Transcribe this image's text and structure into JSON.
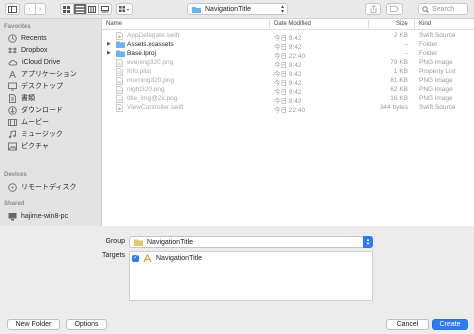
{
  "toolbar": {
    "path_folder": "NavigationTitle",
    "search_placeholder": "Search"
  },
  "sidebar": {
    "favorites_header": "Favorites",
    "favorites": [
      {
        "label": "Recents",
        "icon": "clock-icon"
      },
      {
        "label": "Dropbox",
        "icon": "dropbox-icon"
      },
      {
        "label": "iCloud Drive",
        "icon": "cloud-icon"
      },
      {
        "label": "アプリケーション",
        "icon": "applications-icon"
      },
      {
        "label": "デスクトップ",
        "icon": "desktop-icon"
      },
      {
        "label": "書類",
        "icon": "documents-icon"
      },
      {
        "label": "ダウンロード",
        "icon": "downloads-icon"
      },
      {
        "label": "ムービー",
        "icon": "movies-icon"
      },
      {
        "label": "ミュージック",
        "icon": "music-icon"
      },
      {
        "label": "ピクチャ",
        "icon": "pictures-icon"
      }
    ],
    "devices_header": "Devices",
    "devices": [
      {
        "label": "リモートディスク",
        "icon": "remote-disc-icon"
      }
    ],
    "shared_header": "Shared",
    "shared": [
      {
        "label": "hajime-win8-pc",
        "icon": "pc-icon"
      }
    ]
  },
  "columns": {
    "name": "Name",
    "date": "Date Modified",
    "size": "Size",
    "kind": "Kind"
  },
  "files": [
    {
      "name": "AppDelegate.swift",
      "date": "今日 9:42",
      "size": "2 KB",
      "kind": "Swift Source",
      "icon": "swift-file-icon"
    },
    {
      "name": "Assets.xcassets",
      "date": "今日 9:42",
      "size": "--",
      "kind": "Folder",
      "icon": "folder-icon"
    },
    {
      "name": "Base.lproj",
      "date": "今日 22:40",
      "size": "--",
      "kind": "Folder",
      "icon": "folder-icon"
    },
    {
      "name": "evening320.png",
      "date": "今日 9:42",
      "size": "79 KB",
      "kind": "PNG image",
      "icon": "image-file-icon"
    },
    {
      "name": "Info.plist",
      "date": "今日 9:42",
      "size": "1 KB",
      "kind": "Property List",
      "icon": "plist-file-icon"
    },
    {
      "name": "morning320.png",
      "date": "今日 9:42",
      "size": "81 KB",
      "kind": "PNG image",
      "icon": "image-file-icon"
    },
    {
      "name": "night320.png",
      "date": "今日 9:42",
      "size": "62 KB",
      "kind": "PNG image",
      "icon": "image-file-icon"
    },
    {
      "name": "title_img@2x.png",
      "date": "今日 9:42",
      "size": "16 KB",
      "kind": "PNG image",
      "icon": "image-file-icon"
    },
    {
      "name": "ViewController.swift",
      "date": "今日 22:40",
      "size": "344 bytes",
      "kind": "Swift Source",
      "icon": "swift-file-icon"
    }
  ],
  "group": {
    "label": "Group",
    "value": "NavigationTitle"
  },
  "targets": {
    "label": "Targets",
    "items": [
      {
        "label": "NavigationTitle",
        "checked": true,
        "icon": "app-target-icon"
      }
    ]
  },
  "buttons": {
    "new_folder": "New Folder",
    "options": "Options",
    "cancel": "Cancel",
    "create": "Create"
  },
  "colors": {
    "accent": "#2f7bf5",
    "folder": "#6cb2f0"
  }
}
